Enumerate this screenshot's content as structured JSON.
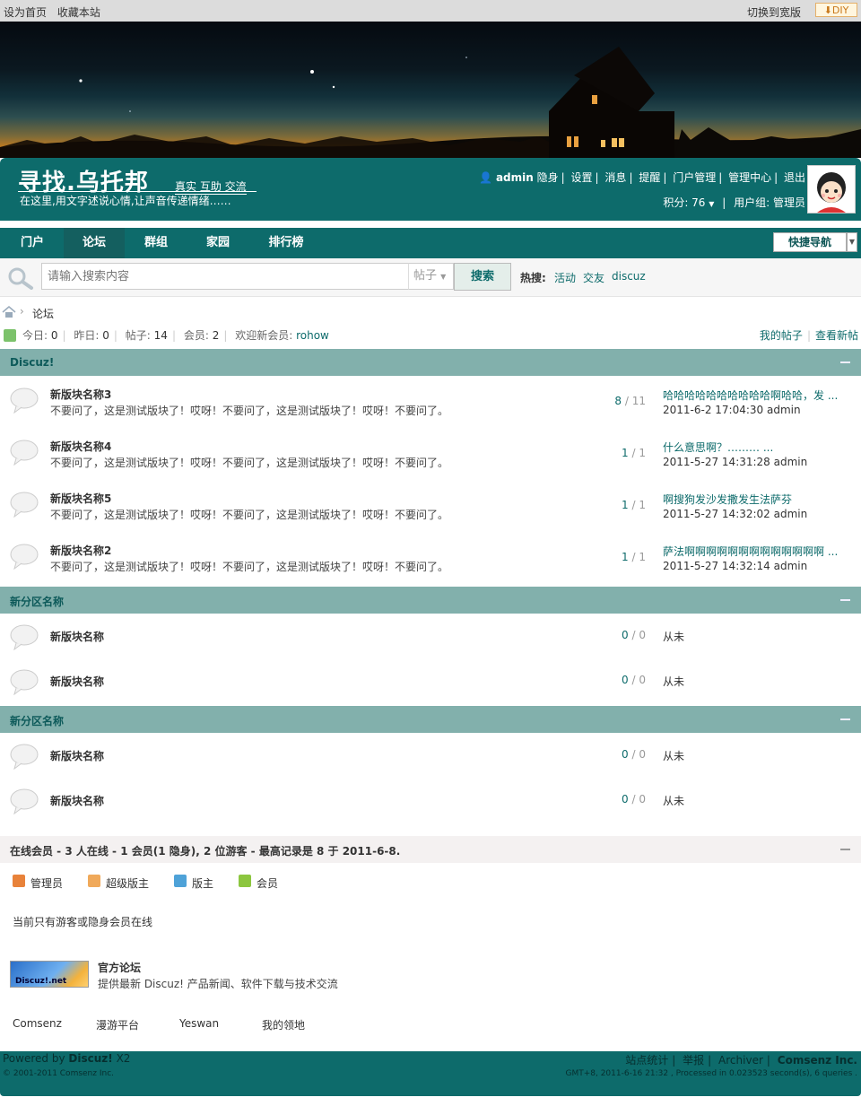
{
  "topbar": {
    "set_home": "设为首页",
    "bookmark": "收藏本站",
    "switch_wide": "切换到宽版",
    "diy": "DIY"
  },
  "logo": {
    "main": "寻找.乌托邦",
    "sub": "真实 互助 交流",
    "slogan": "在这里,用文字述说心情,让声音传递情绪……"
  },
  "user": {
    "name": "admin",
    "links": [
      "隐身",
      "设置",
      "消息",
      "提醒",
      "门户管理",
      "管理中心",
      "退出"
    ],
    "points": "积分: 76",
    "group": "用户组: 管理员"
  },
  "nav": {
    "items": [
      "门户",
      "论坛",
      "群组",
      "家园",
      "排行榜"
    ],
    "active": "论坛",
    "quick_nav": "快捷导航"
  },
  "search": {
    "placeholder": "请输入搜索内容",
    "type": "帖子",
    "button": "搜索",
    "hot_label": "热搜:",
    "hot_terms": [
      "活动",
      "交友",
      "discuz"
    ]
  },
  "breadcrumb": {
    "current": "论坛"
  },
  "stats": {
    "today_label": "今日:",
    "today": "0",
    "yesterday_label": "昨日:",
    "yesterday": "0",
    "posts_label": "帖子:",
    "posts": "14",
    "members_label": "会员:",
    "members": "2",
    "welcome_label": "欢迎新会员:",
    "new_member": "rohow",
    "my_posts": "我的帖子",
    "view_new": "查看新帖"
  },
  "categories": [
    {
      "title": "Discuz!",
      "forums": [
        {
          "name": "新版块名称3",
          "desc": "不要问了，这是测试版块了！哎呀！不要问了，这是测试版块了！哎呀！不要问了。",
          "threads": "8",
          "posts": "11",
          "last_title": "哈哈哈哈哈哈哈哈哈哈啊哈哈，发 ...",
          "last_info": "2011-6-2 17:04:30 admin"
        },
        {
          "name": "新版块名称4",
          "desc": "不要问了，这是测试版块了！哎呀！不要问了，这是测试版块了！哎呀！不要问了。",
          "threads": "1",
          "posts": "1",
          "last_title": "什么意思啊？……… ...",
          "last_info": "2011-5-27 14:31:28 admin"
        },
        {
          "name": "新版块名称5",
          "desc": "不要问了，这是测试版块了！哎呀！不要问了，这是测试版块了！哎呀！不要问了。",
          "threads": "1",
          "posts": "1",
          "last_title": "啊搜狗发沙发撒发生法萨芬",
          "last_info": "2011-5-27 14:32:02 admin"
        },
        {
          "name": "新版块名称2",
          "desc": "不要问了，这是测试版块了！哎呀！不要问了，这是测试版块了！哎呀！不要问了。",
          "threads": "1",
          "posts": "1",
          "last_title": "萨法啊啊啊啊啊啊啊啊啊啊啊啊啊 ...",
          "last_info": "2011-5-27 14:32:14 admin"
        }
      ]
    },
    {
      "title": "新分区名称",
      "forums": [
        {
          "name": "新版块名称",
          "threads": "0",
          "posts": "0",
          "last_title": "从未"
        },
        {
          "name": "新版块名称",
          "threads": "0",
          "posts": "0",
          "last_title": "从未"
        }
      ]
    },
    {
      "title": "新分区名称",
      "forums": [
        {
          "name": "新版块名称",
          "threads": "0",
          "posts": "0",
          "last_title": "从未"
        },
        {
          "name": "新版块名称",
          "threads": "0",
          "posts": "0",
          "last_title": "从未"
        }
      ]
    }
  ],
  "online": {
    "title": "在线会员 - 3 人在线 - 1 会员(1 隐身), 2 位游客 - 最高记录是 8 于 2011-6-8.",
    "legend": [
      {
        "label": "管理员",
        "color": "#e8823a"
      },
      {
        "label": "超级版主",
        "color": "#f0a95a"
      },
      {
        "label": "版主",
        "color": "#4ea2d8"
      },
      {
        "label": "会员",
        "color": "#8cc63f"
      }
    ],
    "note": "当前只有游客或隐身会员在线"
  },
  "official": {
    "logo_text": "Discuz!.net",
    "title": "官方论坛",
    "desc": "提供最新 Discuz! 产品新闻、软件下载与技术交流"
  },
  "friend_links": [
    "Comsenz",
    "漫游平台",
    "Yeswan",
    "我的领地"
  ],
  "footer": {
    "powered_prefix": "Powered by",
    "powered_name": "Discuz!",
    "powered_version": "X2",
    "copyright": "© 2001-2011 Comsenz Inc.",
    "links": [
      "站点统计",
      "举报",
      "Archiver",
      "Comsenz Inc."
    ],
    "gmt": "GMT+8, 2011-6-16 21:32 , Processed in 0.023523 second(s), 6 queries ."
  }
}
